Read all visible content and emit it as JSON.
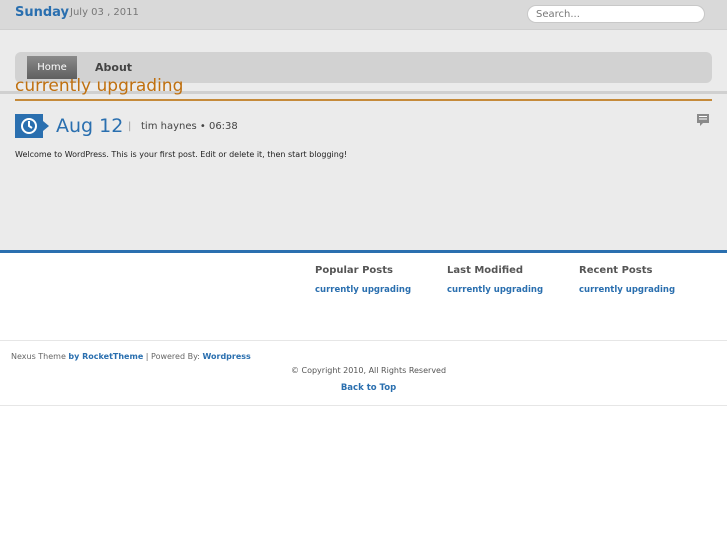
{
  "header": {
    "day": "Sunday",
    "date": "July 03 , 2011",
    "search_placeholder": "Search..."
  },
  "nav": {
    "items": [
      {
        "label": "Home",
        "active": true
      },
      {
        "label": "About",
        "active": false
      }
    ]
  },
  "post": {
    "title": "currently upgrading",
    "date": "Aug 12",
    "separator": "|",
    "meta": "tim haynes • 06:38",
    "body": "Welcome to WordPress. This is your first post. Edit or delete it, then start blogging!",
    "icons": [
      "clock-icon",
      "comment-icon"
    ]
  },
  "footer": {
    "columns": [
      {
        "heading": "Popular Posts",
        "link": "currently upgrading"
      },
      {
        "heading": "Last Modified",
        "link": "currently upgrading"
      },
      {
        "heading": "Recent Posts",
        "link": "currently upgrading"
      }
    ],
    "credit": {
      "prefix": "Nexus Theme ",
      "theme_link": "by RocketTheme",
      "middle": " | Powered By: ",
      "platform_link": "Wordpress"
    },
    "copyright": "© Copyright 2010, All Rights Reserved",
    "back_to_top": "Back to Top"
  },
  "colors": {
    "brand_blue": "#2a6faf",
    "title_orange": "#c0700f"
  }
}
